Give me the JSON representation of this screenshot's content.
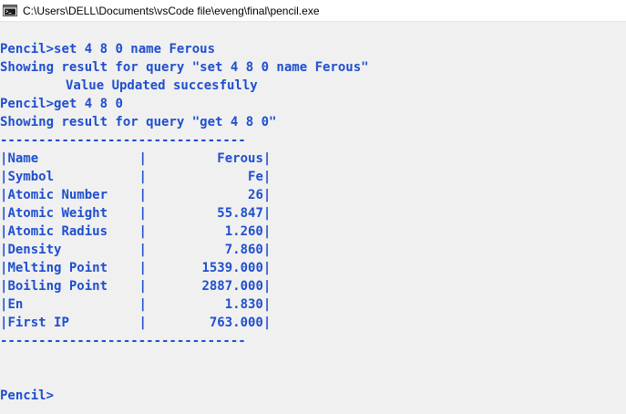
{
  "window": {
    "title": "C:\\Users\\DELL\\Documents\\vsCode file\\eveng\\final\\pencil.exe",
    "icon": "console-app-icon"
  },
  "console": {
    "prompt": "Pencil>",
    "cmd1": "set 4 8 0 name Ferous",
    "result1": "Showing result for query \"set 4 8 0 name Ferous\"",
    "status1": "Value Updated succesfully",
    "cmd2": "get 4 8 0",
    "result2": "Showing result for query \"get 4 8 0\"",
    "separator": "--------------------------------",
    "pipe": "|",
    "rows": [
      {
        "name": "Name",
        "value": "Ferous"
      },
      {
        "name": "Symbol",
        "value": "Fe"
      },
      {
        "name": "Atomic Number",
        "value": "26"
      },
      {
        "name": "Atomic Weight",
        "value": "55.847"
      },
      {
        "name": "Atomic Radius",
        "value": "1.260"
      },
      {
        "name": "Density",
        "value": "7.860"
      },
      {
        "name": "Melting Point",
        "value": "1539.000"
      },
      {
        "name": "Boiling Point",
        "value": "2887.000"
      },
      {
        "name": "En",
        "value": "1.830"
      },
      {
        "name": "First IP",
        "value": "763.000"
      }
    ]
  },
  "colors": {
    "text": "#1f4fcf",
    "background": "#f0f0f0",
    "titlebar": "#ffffff"
  }
}
